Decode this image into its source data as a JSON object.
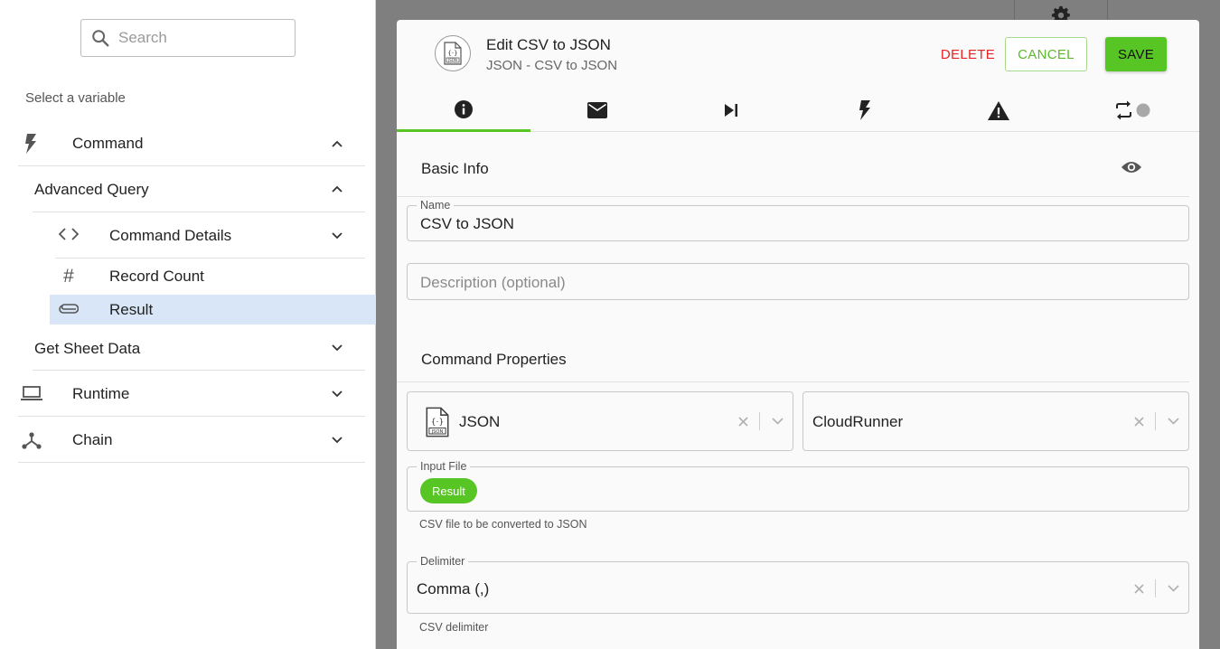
{
  "search": {
    "placeholder": "Search"
  },
  "picker": {
    "select_label": "Select a variable",
    "items": [
      {
        "label": "Command",
        "icon": "lightning-icon",
        "expanded": true
      },
      {
        "label": "Advanced Query",
        "expanded": true
      },
      {
        "label": "Command Details",
        "icon": "code-icon",
        "expanded": false
      },
      {
        "label": "Record Count",
        "icon": "hash-icon"
      },
      {
        "label": "Result",
        "icon": "paperclip-icon",
        "selected": true
      },
      {
        "label": "Get Sheet Data",
        "expanded": false
      },
      {
        "label": "Runtime",
        "icon": "laptop-icon",
        "expanded": false
      },
      {
        "label": "Chain",
        "icon": "chain-icon",
        "expanded": false
      }
    ]
  },
  "modal": {
    "title": "Edit CSV to JSON",
    "subtitle": "JSON - CSV to JSON",
    "header_icon": "json-file-icon",
    "buttons": {
      "delete": "DELETE",
      "cancel": "CANCEL",
      "save": "SAVE"
    },
    "tabs": [
      {
        "icon": "info-icon",
        "active": true
      },
      {
        "icon": "mail-icon"
      },
      {
        "icon": "skip-next-icon"
      },
      {
        "icon": "lightning-icon"
      },
      {
        "icon": "warning-icon"
      },
      {
        "icon": "repeat-icon"
      }
    ],
    "basic_info": {
      "title": "Basic Info",
      "name_label": "Name",
      "name_value": "CSV to JSON",
      "description_placeholder": "Description (optional)"
    },
    "command_properties": {
      "title": "Command Properties",
      "connector_value": "JSON",
      "connector_icon": "json-file-icon",
      "runner_value": "CloudRunner",
      "input_file_label": "Input File",
      "input_file_chip": "Result",
      "input_file_helper": "CSV file to be converted to JSON",
      "delimiter_label": "Delimiter",
      "delimiter_value": "Comma (,)",
      "delimiter_helper": "CSV delimiter"
    }
  },
  "colors": {
    "accent": "#57c524",
    "danger": "#e52525",
    "selected_row": "#d8e6f8",
    "backdrop": "#7f7f7f"
  }
}
